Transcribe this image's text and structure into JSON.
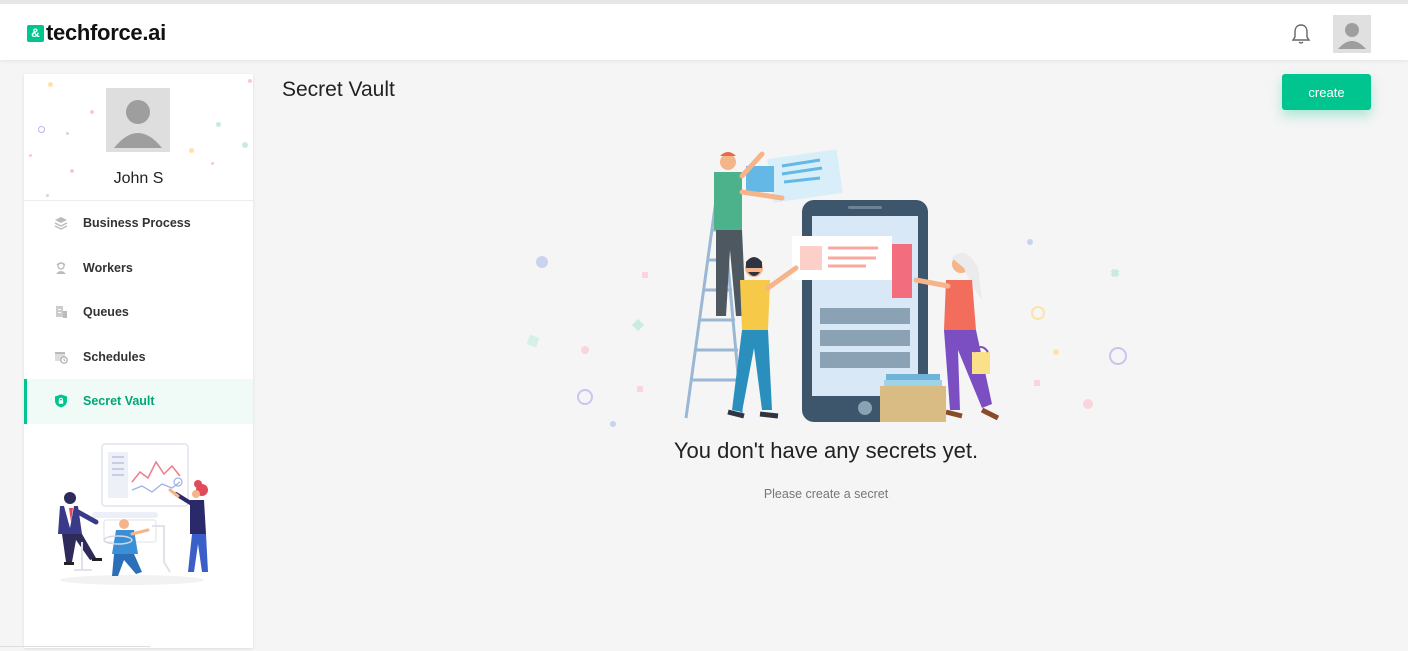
{
  "brand": {
    "badge": "&",
    "name": "techforce.ai",
    "accent": "#00c58e"
  },
  "header": {
    "icons": [
      "bell-icon",
      "user-avatar-icon"
    ]
  },
  "sidebar": {
    "user_name": "John S",
    "items": [
      {
        "label": "Business Process",
        "icon": "layers-icon",
        "active": false
      },
      {
        "label": "Workers",
        "icon": "worker-icon",
        "active": false
      },
      {
        "label": "Queues",
        "icon": "queue-icon",
        "active": false
      },
      {
        "label": "Schedules",
        "icon": "schedule-icon",
        "active": false
      },
      {
        "label": "Secret Vault",
        "icon": "shield-lock-icon",
        "active": true
      }
    ]
  },
  "main": {
    "title": "Secret Vault",
    "create_label": "create",
    "empty_title": "You don't have any secrets yet.",
    "empty_subtitle": "Please create a secret"
  }
}
